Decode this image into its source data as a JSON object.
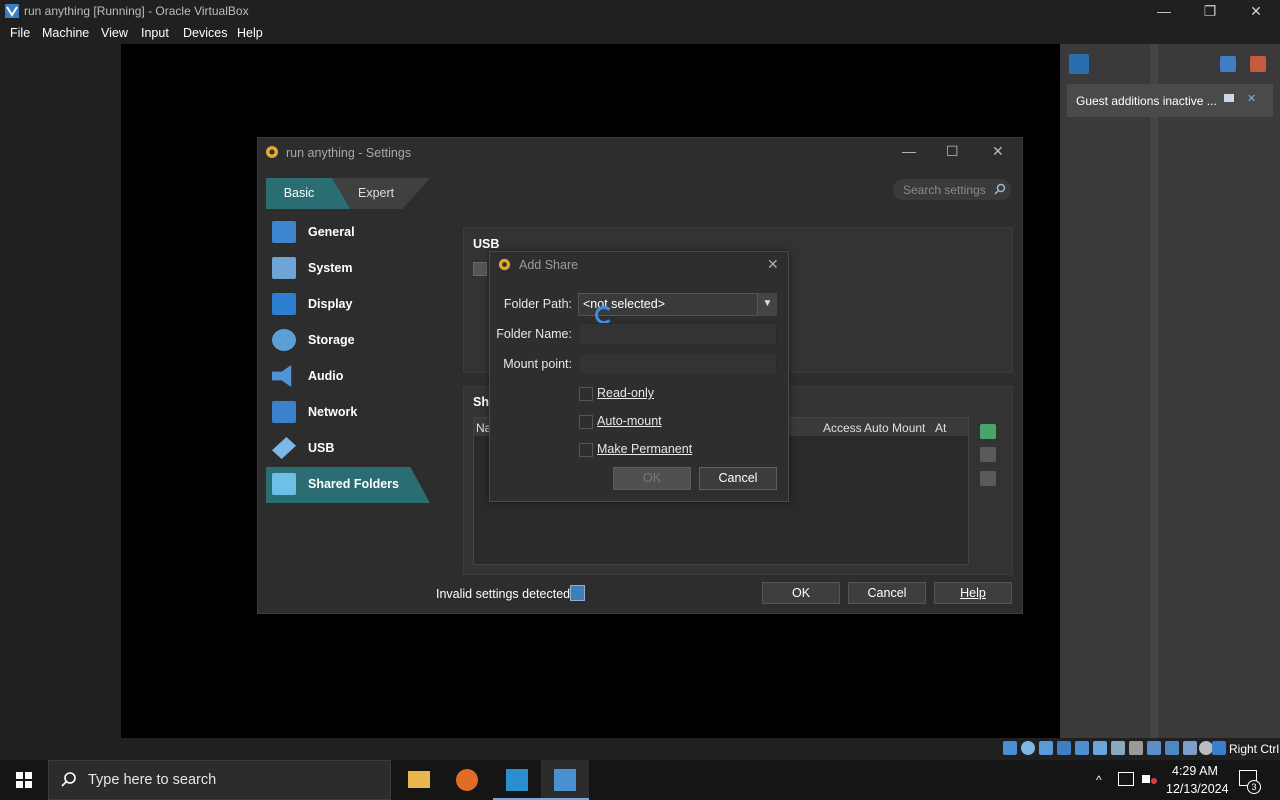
{
  "host": {
    "title": "run anything [Running] - Oracle VirtualBox",
    "menu": [
      "File",
      "Machine",
      "View",
      "Input",
      "Devices",
      "Help"
    ],
    "minimize": "—",
    "restore": "❐",
    "close": "✕"
  },
  "notification": {
    "text": "Guest additions inactive ...",
    "close": "✕"
  },
  "settings": {
    "title": "run anything - Settings",
    "modes": {
      "basic": "Basic",
      "expert": "Expert"
    },
    "search_placeholder": "Search settings",
    "nav": [
      "General",
      "System",
      "Display",
      "Storage",
      "Audio",
      "Network",
      "USB",
      "Shared Folders"
    ],
    "active_nav": "Shared Folders",
    "usb_header": "USB",
    "shared_header": "Sha",
    "table_columns": [
      "Na",
      "Access",
      "Auto Mount",
      "At"
    ],
    "invalid_label": "Invalid settings detected",
    "buttons": {
      "ok": "OK",
      "cancel": "Cancel",
      "help": "Help"
    }
  },
  "add_share": {
    "title": "Add Share",
    "close": "✕",
    "folder_path_label": "Folder Path:",
    "folder_path_value": "<not selected>",
    "folder_name_label": "Folder Name:",
    "folder_name_value": "",
    "mount_point_label": "Mount point:",
    "mount_point_value": "",
    "read_only": "Read-only",
    "auto_mount": "Auto-mount",
    "make_permanent": "Make Permanent",
    "ok": "OK",
    "cancel": "Cancel"
  },
  "statusbar": {
    "host_key": "Right Ctrl"
  },
  "taskbar": {
    "search_placeholder": "Type here to search",
    "time": "4:29 AM",
    "date": "12/13/2024",
    "notification_count": "3"
  },
  "colors": {
    "accent": "#2a6e73",
    "busy": "#3d8ee0"
  }
}
